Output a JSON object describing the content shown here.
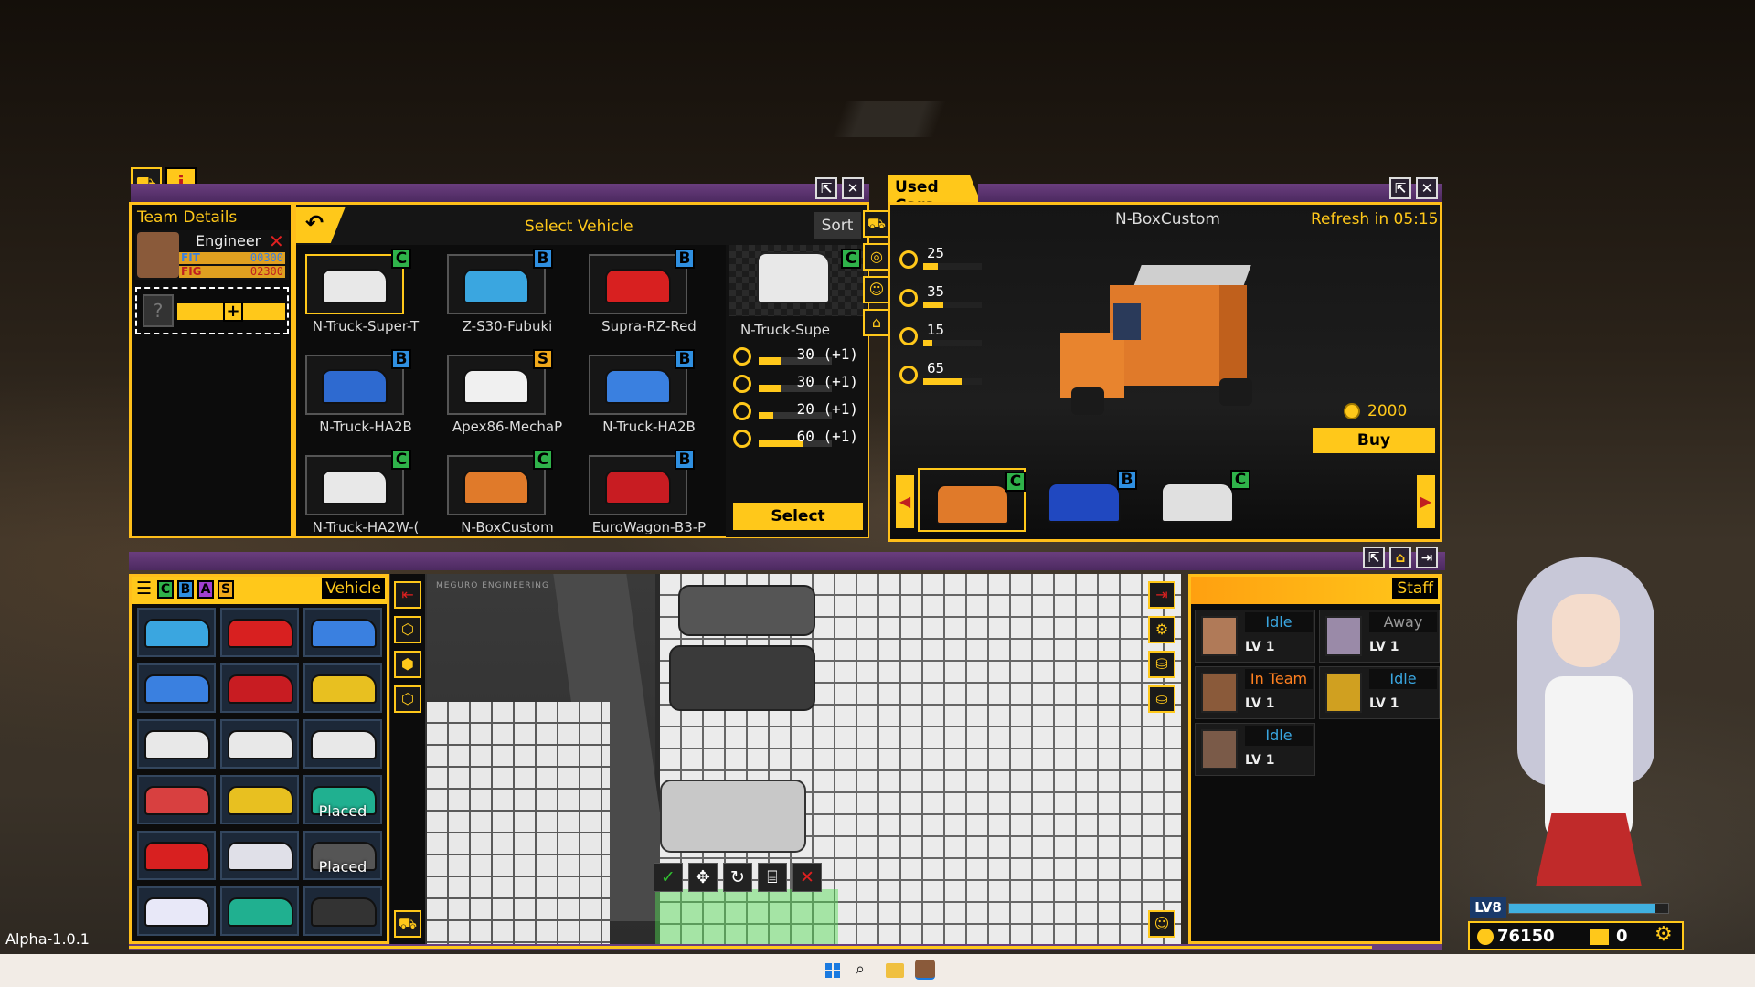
{
  "version": "Alpha-1.0.1",
  "team_details": {
    "title": "Team Details",
    "member": {
      "role": "Engineer",
      "fit_label": "FIT",
      "fit_value": "00300",
      "fig_label": "FIG",
      "fig_value": "02300"
    },
    "slot_placeholder": "?"
  },
  "select_vehicle": {
    "title": "Select Vehicle",
    "sort_label": "Sort",
    "vehicles": [
      {
        "name": "N-Truck-Super-T",
        "grade": "C",
        "color": "#e8e8e8"
      },
      {
        "name": "Z-S30-Fubuki",
        "grade": "B",
        "color": "#3aa6e0"
      },
      {
        "name": "Supra-RZ-Red",
        "grade": "B",
        "color": "#d82020"
      },
      {
        "name": "N-Truck-HA2B",
        "grade": "B",
        "color": "#2e6ad0"
      },
      {
        "name": "Apex86-MechaP",
        "grade": "S",
        "color": "#f0f0f0"
      },
      {
        "name": "N-Truck-HA2B",
        "grade": "B",
        "color": "#3a80e0"
      },
      {
        "name": "N-Truck-HA2W-(",
        "grade": "C",
        "color": "#e8e8e8"
      },
      {
        "name": "N-BoxCustom",
        "grade": "C",
        "color": "#e07a2a"
      },
      {
        "name": "EuroWagon-B3-P",
        "grade": "B",
        "color": "#c81c22"
      }
    ],
    "preview": {
      "name": "N-Truck-Supe",
      "grade": "C",
      "stats": [
        {
          "icon": "speed-icon",
          "value": "30 (+1)",
          "fill": 0.3
        },
        {
          "icon": "steering-icon",
          "value": "30 (+1)",
          "fill": 0.3
        },
        {
          "icon": "drift-icon",
          "value": "20 (+1)",
          "fill": 0.2
        },
        {
          "icon": "fuel-icon",
          "value": "60 (+1)",
          "fill": 0.6
        }
      ],
      "select_label": "Select"
    }
  },
  "used_cars": {
    "tab_label": "Used Cars",
    "car_name": "N-BoxCustom",
    "refresh_label": "Refresh in 05:15",
    "stats": [
      {
        "icon": "speed-icon",
        "value": "25",
        "fill": 0.25
      },
      {
        "icon": "steering-icon",
        "value": "35",
        "fill": 0.35
      },
      {
        "icon": "drift-icon",
        "value": "15",
        "fill": 0.15
      },
      {
        "icon": "fuel-icon",
        "value": "65",
        "fill": 0.65
      }
    ],
    "price": "2000",
    "buy_label": "Buy",
    "carousel": [
      {
        "grade": "C",
        "color": "#e07a2a"
      },
      {
        "grade": "B",
        "color": "#2048c0"
      },
      {
        "grade": "C",
        "color": "#e0e0e0"
      }
    ]
  },
  "inventory": {
    "filters": [
      "C",
      "B",
      "A",
      "S"
    ],
    "tab_label": "Vehicle",
    "cars": [
      {
        "color": "#3aa6e0",
        "label": ""
      },
      {
        "color": "#d82020",
        "label": ""
      },
      {
        "color": "#3a80e0",
        "label": ""
      },
      {
        "color": "#3a80e0",
        "label": ""
      },
      {
        "color": "#c81c22",
        "label": ""
      },
      {
        "color": "#e8c020",
        "label": ""
      },
      {
        "color": "#e8e8e8",
        "label": ""
      },
      {
        "color": "#e8e8e8",
        "label": ""
      },
      {
        "color": "#e8e8e8",
        "label": ""
      },
      {
        "color": "#d84040",
        "label": ""
      },
      {
        "color": "#e8c020",
        "label": ""
      },
      {
        "color": "#20b090",
        "label": "Placed"
      },
      {
        "color": "#d82020",
        "label": ""
      },
      {
        "color": "#e0e0e8",
        "label": ""
      },
      {
        "color": "#555555",
        "label": "Placed"
      },
      {
        "color": "#e8e8f8",
        "label": ""
      },
      {
        "color": "#20b090",
        "label": ""
      },
      {
        "color": "#333333",
        "label": ""
      }
    ]
  },
  "garage": {
    "sign_text": "MEGURO ENGINEERING"
  },
  "staff": {
    "title": "Staff",
    "members": [
      {
        "status": "Idle",
        "level": "LV 1",
        "status_color": "#3aa6e0",
        "face": "#b07a58"
      },
      {
        "status": "Away",
        "level": "LV 1",
        "status_color": "#999999",
        "face": "#9a8aa8"
      },
      {
        "status": "In Team",
        "level": "LV 1",
        "status_color": "#ff8020",
        "face": "#8a5a3a"
      },
      {
        "status": "Idle",
        "level": "LV 1",
        "status_color": "#3aa6e0",
        "face": "#d0a020"
      },
      {
        "status": "Idle",
        "level": "LV 1",
        "status_color": "#3aa6e0",
        "face": "#7a5a48"
      }
    ]
  },
  "player": {
    "level_label": "LV8",
    "coins": "76150",
    "tickets": "0"
  }
}
